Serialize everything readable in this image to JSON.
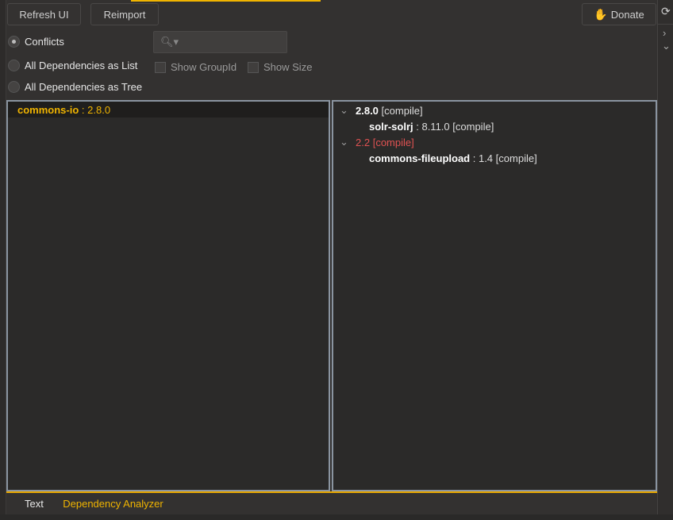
{
  "toolbar": {
    "refresh": "Refresh UI",
    "reimport": "Reimport",
    "donate": "Donate"
  },
  "modes": [
    {
      "label": "Conflicts",
      "selected": true
    },
    {
      "label": "All Dependencies as List",
      "selected": false
    },
    {
      "label": "All Dependencies as Tree",
      "selected": false
    }
  ],
  "search": {
    "placeholder": ""
  },
  "options": {
    "show_groupid": "Show GroupId",
    "show_size": "Show Size"
  },
  "conflicts": [
    {
      "name": "commons-io",
      "sep": " : ",
      "version": "2.8.0"
    }
  ],
  "tree": [
    {
      "version": "2.8.0",
      "scope": "[compile]",
      "conflict": false,
      "children": [
        {
          "name": "solr-solrj",
          "sep": " : ",
          "version": "8.11.0",
          "scope": "[compile]"
        }
      ]
    },
    {
      "version": "2.2",
      "scope": "[compile]",
      "conflict": true,
      "children": [
        {
          "name": "commons-fileupload",
          "sep": " : ",
          "version": "1.4",
          "scope": "[compile]"
        }
      ]
    }
  ],
  "tabs": [
    {
      "label": "Text",
      "active": false
    },
    {
      "label": "Dependency Analyzer",
      "active": true
    }
  ],
  "colors": {
    "accent": "#f0b400",
    "conflict": "#e05252"
  }
}
